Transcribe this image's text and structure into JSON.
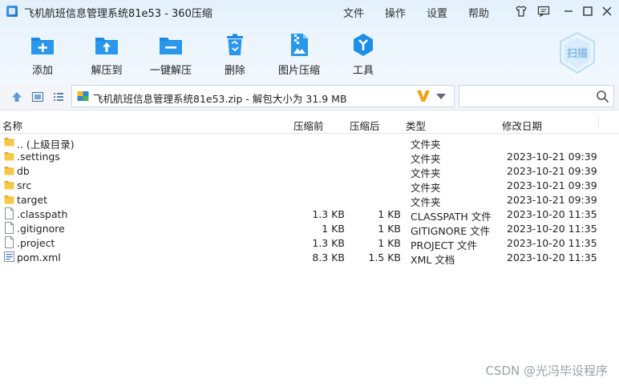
{
  "window": {
    "title": "飞机航班信息管理系统81e53 - 360压缩",
    "menu": [
      "文件",
      "操作",
      "设置",
      "帮助"
    ]
  },
  "toolbar": {
    "tools": [
      {
        "label": "添加",
        "icon": "add-icon"
      },
      {
        "label": "解压到",
        "icon": "extract-to-icon"
      },
      {
        "label": "一键解压",
        "icon": "one-click-extract-icon"
      },
      {
        "label": "删除",
        "icon": "delete-icon"
      },
      {
        "label": "图片压缩",
        "icon": "image-compress-icon"
      },
      {
        "label": "工具",
        "icon": "tools-icon"
      }
    ],
    "scan_label": "扫描"
  },
  "address": {
    "path": "飞机航班信息管理系统81e53.zip - 解包大小为 31.9 MB",
    "search_placeholder": ""
  },
  "columns": {
    "name": "名称",
    "size": "压缩前",
    "packed": "压缩后",
    "type": "类型",
    "modified": "修改日期"
  },
  "files": [
    {
      "name": ".. (上级目录)",
      "size": "",
      "packed": "",
      "type": "文件夹",
      "modified": "",
      "kind": "folder"
    },
    {
      "name": ".settings",
      "size": "",
      "packed": "",
      "type": "文件夹",
      "modified": "2023-10-21 09:39",
      "kind": "folder"
    },
    {
      "name": "db",
      "size": "",
      "packed": "",
      "type": "文件夹",
      "modified": "2023-10-21 09:39",
      "kind": "folder"
    },
    {
      "name": "src",
      "size": "",
      "packed": "",
      "type": "文件夹",
      "modified": "2023-10-21 09:39",
      "kind": "folder"
    },
    {
      "name": "target",
      "size": "",
      "packed": "",
      "type": "文件夹",
      "modified": "2023-10-21 09:39",
      "kind": "folder"
    },
    {
      "name": ".classpath",
      "size": "1.3 KB",
      "packed": "1 KB",
      "type": "CLASSPATH 文件",
      "modified": "2023-10-20 11:35",
      "kind": "file"
    },
    {
      "name": ".gitignore",
      "size": "1 KB",
      "packed": "1 KB",
      "type": "GITIGNORE 文件",
      "modified": "2023-10-20 11:35",
      "kind": "file"
    },
    {
      "name": ".project",
      "size": "1.3 KB",
      "packed": "1 KB",
      "type": "PROJECT 文件",
      "modified": "2023-10-20 11:35",
      "kind": "file"
    },
    {
      "name": "pom.xml",
      "size": "8.3 KB",
      "packed": "1.5 KB",
      "type": "XML 文档",
      "modified": "2023-10-20 11:35",
      "kind": "xml"
    }
  ],
  "watermark": "CSDN @光冯毕设程序",
  "colors": {
    "accent": "#1e8ee6",
    "folder": "#f5c342",
    "header_bg": "#e8f2fc"
  }
}
